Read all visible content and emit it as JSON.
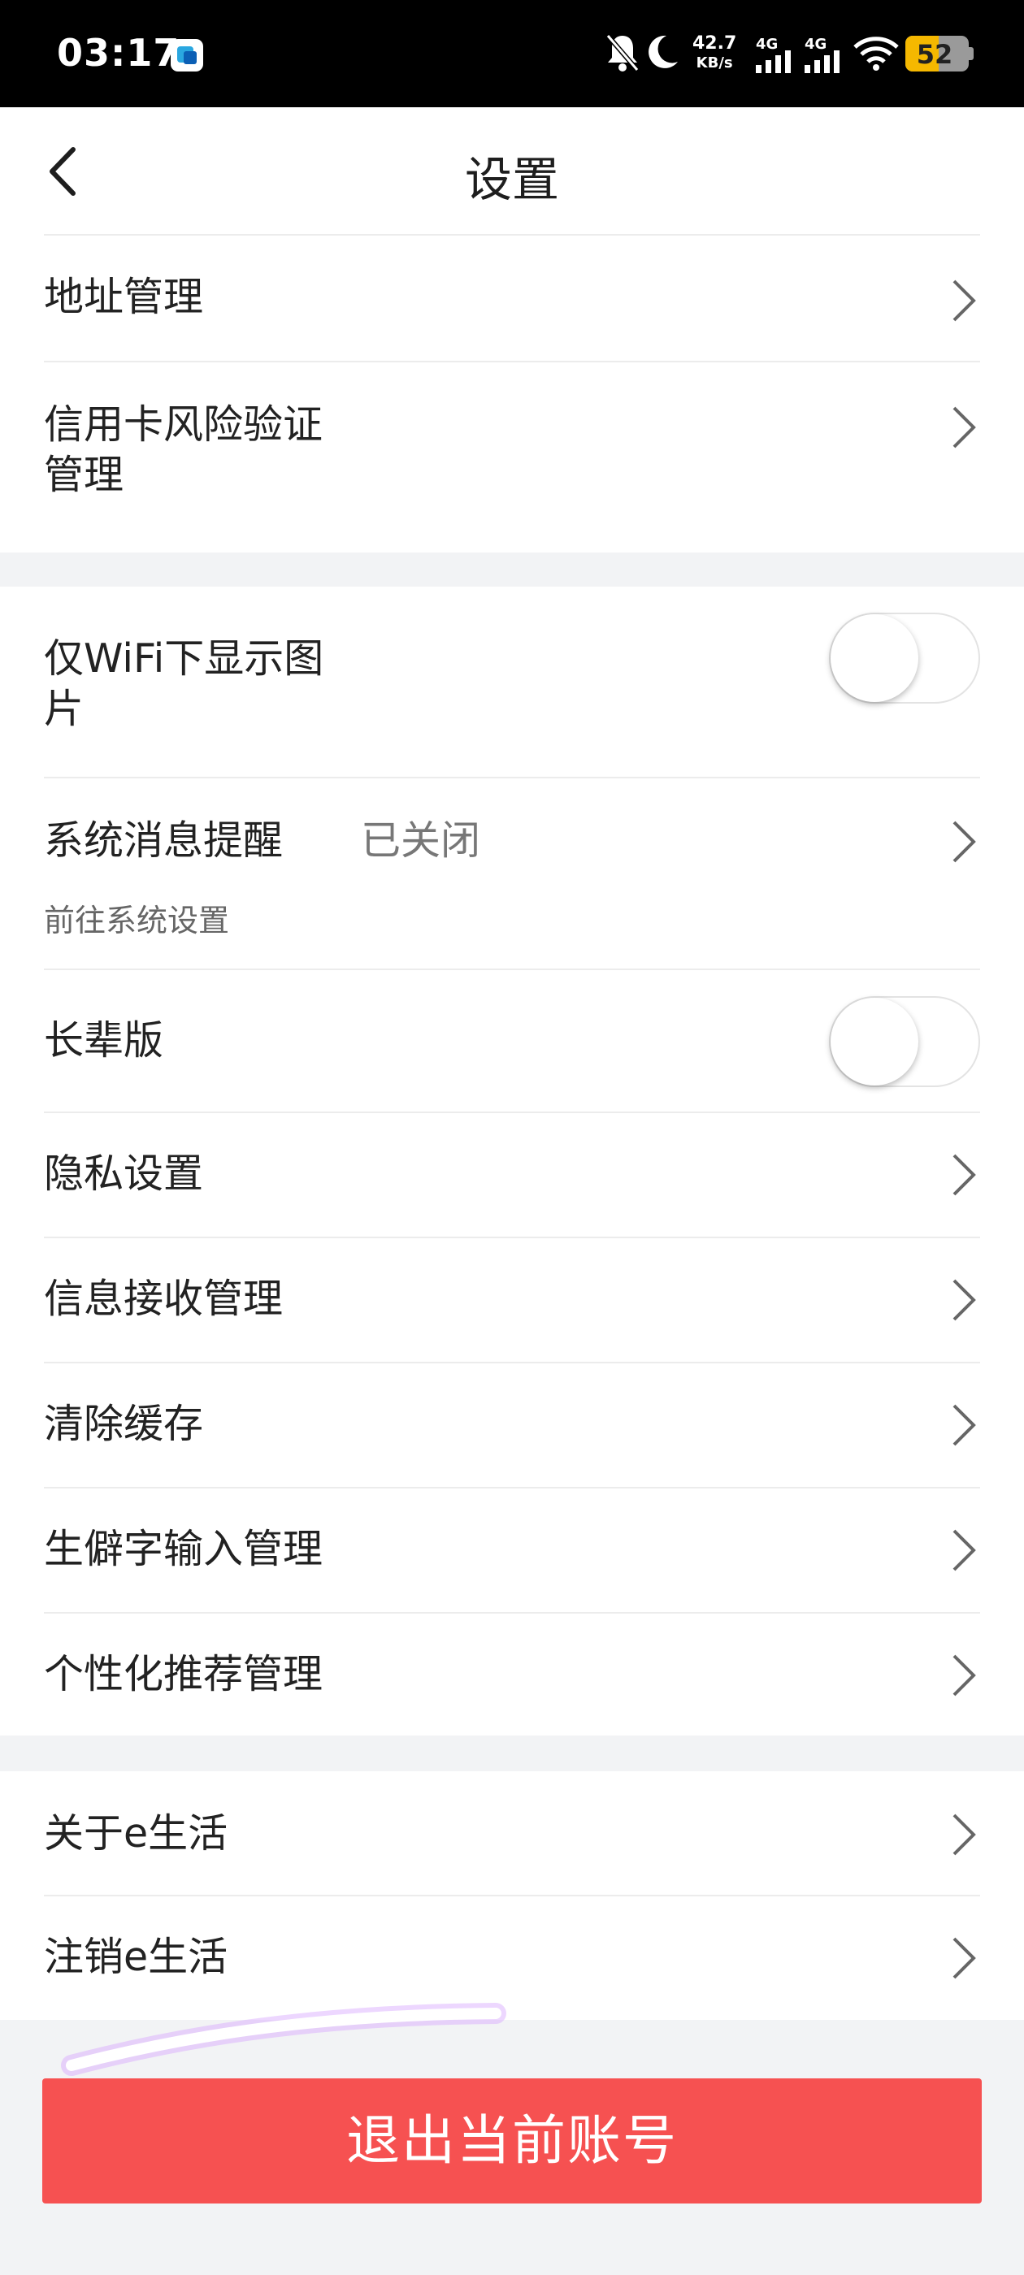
{
  "status_bar": {
    "time": "03:17",
    "net_speed_value": "42.7",
    "net_speed_unit": "KB/s",
    "sim1": "4G",
    "sim2": "4G",
    "battery": "52",
    "battery_level": 0.52,
    "battery_color": "#f5b800"
  },
  "header": {
    "title": "设置",
    "back_icon": "chevron-left-icon"
  },
  "sections": {
    "account": {
      "address": "地址管理",
      "credit_card_line1": "信用卡风险验证",
      "credit_card_line2": "管理"
    },
    "prefs": {
      "wifi_images_line1": "仅WiFi下显示图",
      "wifi_images_line2": "片",
      "wifi_images_on": false,
      "system_notice": "系统消息提醒",
      "system_notice_status": "已关闭",
      "system_notice_sub": "前往系统设置",
      "elder_mode": "长辈版",
      "elder_mode_on": false,
      "privacy": "隐私设置",
      "message_receive": "信息接收管理",
      "clear_cache": "清除缓存",
      "rare_chars": "生僻字输入管理",
      "personalized": "个性化推荐管理"
    },
    "about": {
      "about_app": "关于e生活",
      "cancel_account": "注销e生活"
    }
  },
  "logout_button": "退出当前账号",
  "colors": {
    "accent": "#f65151",
    "background": "#f2f3f5"
  }
}
